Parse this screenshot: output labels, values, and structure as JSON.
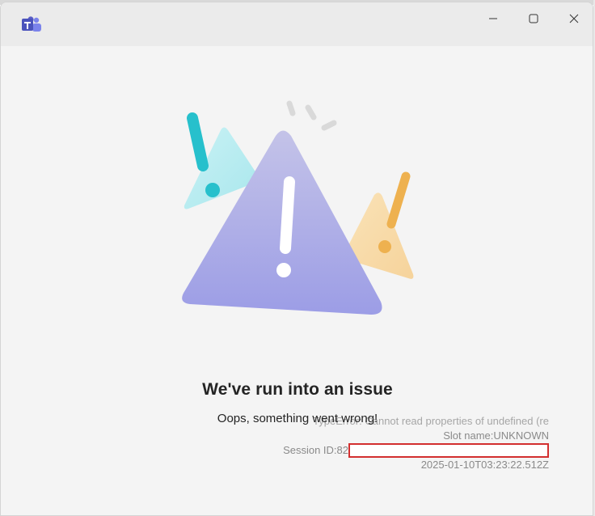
{
  "app": {
    "icon": "teams-icon",
    "accent": "#5b5fc7"
  },
  "window_controls": {
    "minimize": "minimize-icon",
    "maximize": "maximize-icon",
    "close": "close-icon"
  },
  "error": {
    "heading": "We've run into an issue",
    "message": "Oops, something went wrong!",
    "detail_error": "TypeError: Cannot read properties of undefined (re",
    "slot_name": "Slot name:UNKNOWN",
    "session_label": "Session ID:82",
    "timestamp": "2025-01-10T03:23:22.512Z"
  },
  "colors": {
    "warning_main": "#9fa0e6",
    "warning_left": "#b3ecf1",
    "warning_right": "#f6d49a",
    "exclaim_teal": "#27c0cc",
    "exclaim_orange": "#eeb14f",
    "redaction_border": "#d32f2f"
  }
}
